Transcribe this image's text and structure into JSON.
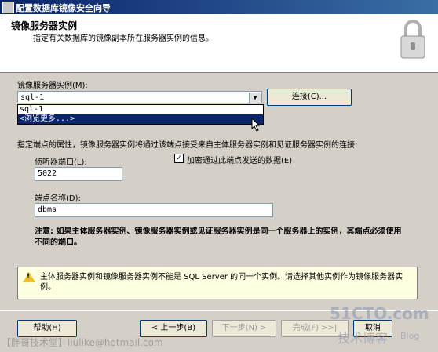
{
  "window": {
    "title": "配置数据库镜像安全向导"
  },
  "header": {
    "title": "镜像服务器实例",
    "subtitle": "指定有关数据库的镜像副本所在服务器实例的信息。"
  },
  "mirror_instance": {
    "label": "镜像服务器实例(M):",
    "value": "sql-1",
    "options": [
      "sql-1",
      "<浏览更多...>"
    ],
    "connect_button": "连接(C)..."
  },
  "endpoint": {
    "description": "指定端点的属性，镜像服务器实例将通过该端点接受来自主体服务器实例和见证服务器实例的连接:",
    "port_label": "侦听器端口(L):",
    "port_value": "5022",
    "encrypt_label": "加密通过此端点发送的数据(E)",
    "encrypt_checked": "✓",
    "name_label": "端点名称(D):",
    "name_value": "dbms"
  },
  "note": "注意: 如果主体服务器实例、镜像服务器实例或见证服务器实例是同一个服务器上的实例，其端点必须使用不同的端口。",
  "warning": "主体服务器实例和镜像服务器实例不能是 SQL Server 的同一个实例。请选择其他实例作为镜像服务器实例。",
  "buttons": {
    "help": "帮助(H)",
    "back": "< 上一步(B)",
    "next": "下一步(N) >",
    "finish": "完成(F) >>|",
    "cancel": "取消"
  },
  "watermarks": {
    "left": "【胖哥技术堂】liulike@hotmail.com",
    "site": "51CTO.com",
    "blog": "技术博客",
    "blog_en": "Blog"
  }
}
